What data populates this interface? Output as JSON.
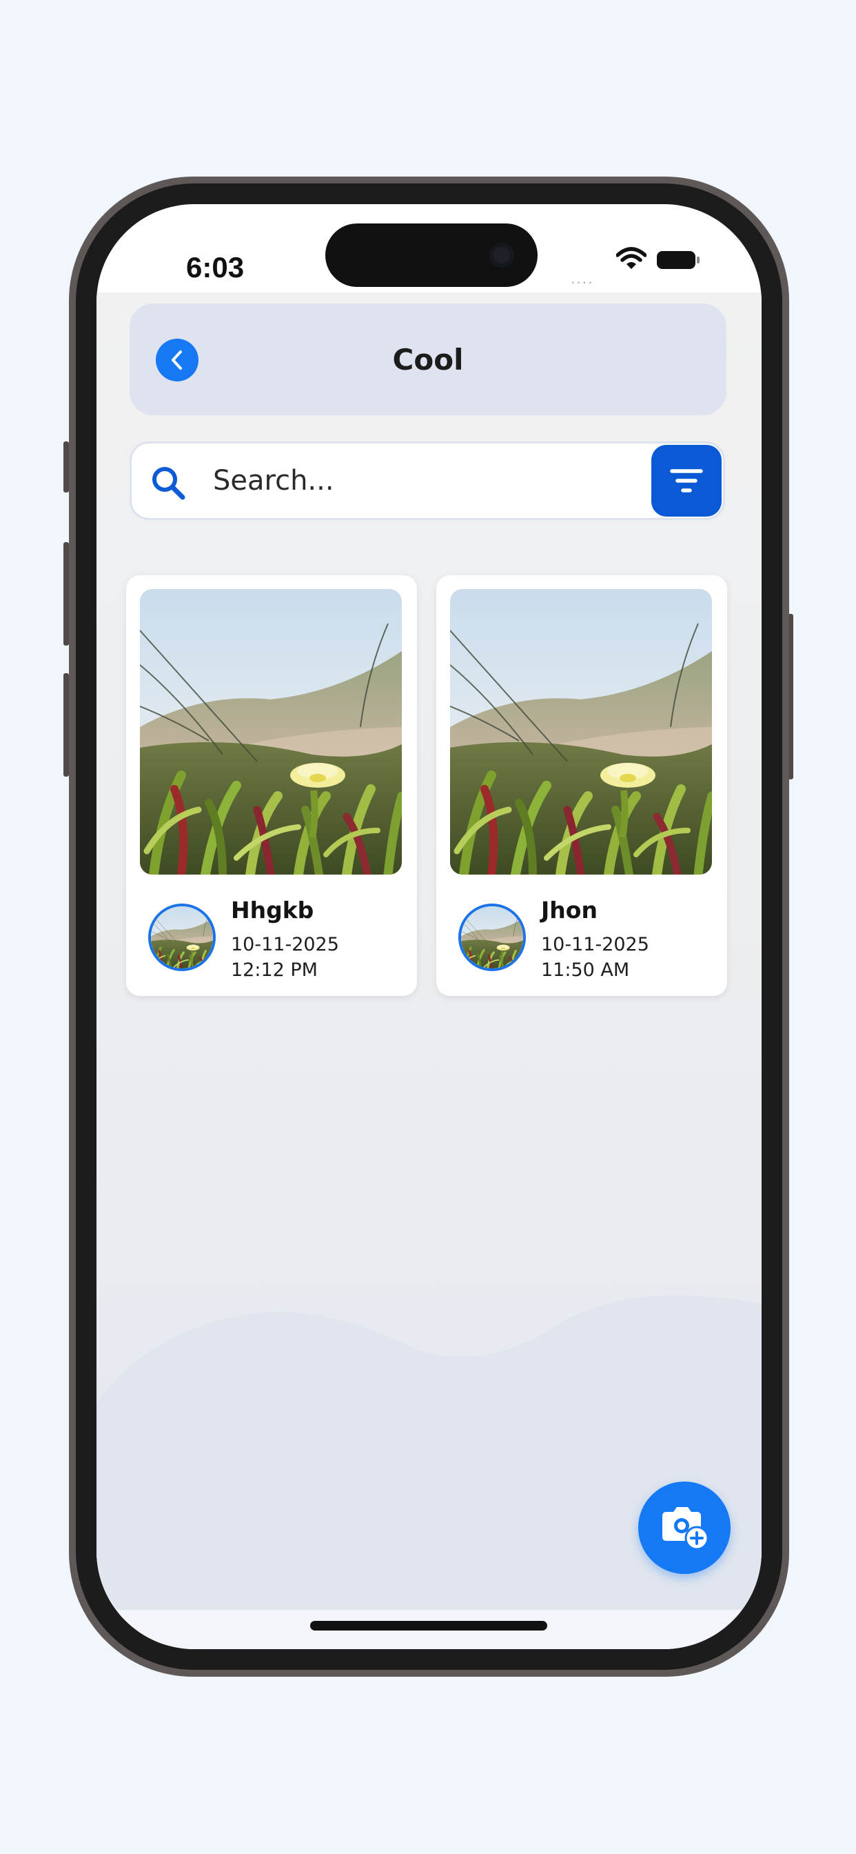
{
  "status_bar": {
    "time": "6:03",
    "signal_dots": "....",
    "icons": [
      "wifi-icon",
      "battery-icon"
    ]
  },
  "header": {
    "title": "Cool",
    "back_icon": "chevron-left-icon"
  },
  "search": {
    "placeholder": "Search...",
    "value": "",
    "icon": "search-icon",
    "filter_icon": "filter-icon"
  },
  "cards": [
    {
      "name": "Hhgkb",
      "date": "10-11-2025",
      "time": "12:12 PM",
      "image": "grass-flower-photo"
    },
    {
      "name": "Jhon",
      "date": "10-11-2025",
      "time": "11:50 AM",
      "image": "grass-flower-photo"
    }
  ],
  "fab": {
    "icon": "camera-add-icon"
  },
  "colors": {
    "accent": "#1678f2",
    "filter_button": "#0a5ad6",
    "header_bg": "#dfe3ef",
    "page_bg": "#f1f6fd"
  }
}
